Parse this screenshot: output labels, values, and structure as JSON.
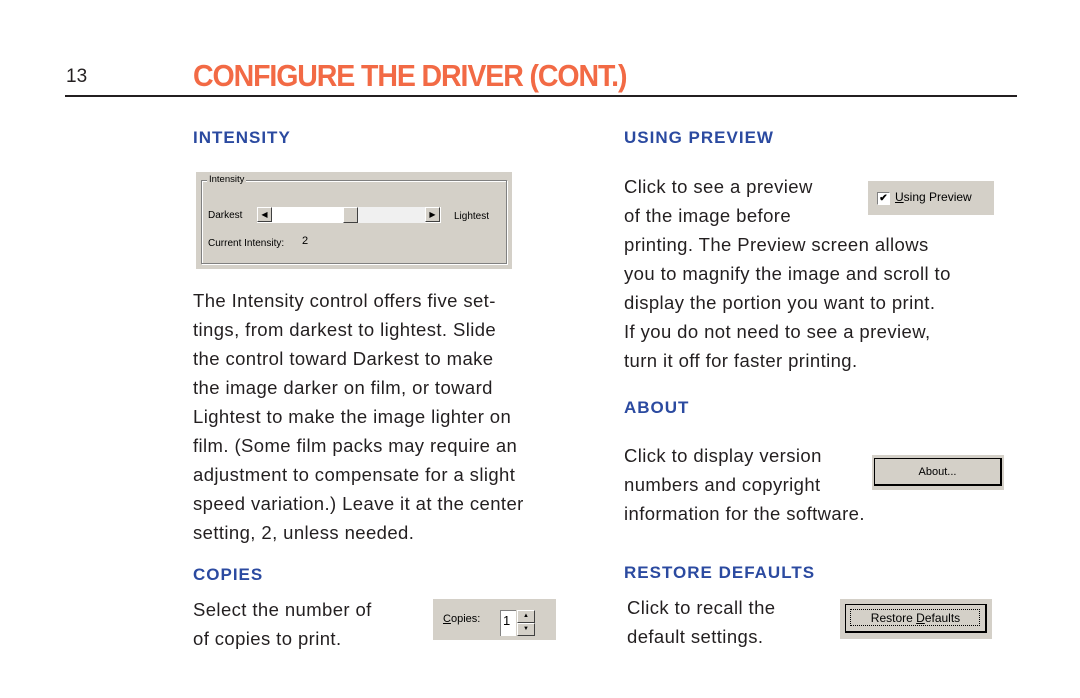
{
  "page": {
    "number": "13",
    "title": "CONFIGURE THE DRIVER (CONT.)",
    "colors": {
      "title": "#f26a45",
      "heading": "#2b4aa0",
      "text": "#231f20",
      "dialog_face": "#d4d0c8"
    }
  },
  "intensity": {
    "heading": "INTENSITY",
    "widget": {
      "group_label": "Intensity",
      "left_label": "Darkest",
      "right_label": "Lightest",
      "current_label": "Current Intensity:",
      "current_value": "2",
      "left_arrow_icon": "◀",
      "right_arrow_icon": "▶",
      "slider_position": "3 of 5 (center)"
    },
    "body_lines": [
      "The Intensity control offers five set-",
      "tings, from darkest to lightest. Slide",
      "the control toward Darkest to make",
      "the image darker on film, or toward",
      "Lightest to make the image lighter on",
      "film. (Some film packs may require an",
      "adjustment to compensate for a slight",
      "speed variation.) Leave it at the center",
      "setting, 2, unless needed."
    ]
  },
  "copies": {
    "heading": "COPIES",
    "body_lines": [
      "Select the number of",
      "of copies to print."
    ],
    "widget": {
      "label_first": "C",
      "label_rest": "opies:",
      "value": "1",
      "up_icon": "▲",
      "down_icon": "▼"
    }
  },
  "using_preview": {
    "heading": "USING PREVIEW",
    "body_lines_short": [
      "Click to see a preview",
      "of the image before"
    ],
    "body_lines": [
      "printing. The Preview screen allows",
      "you to magnify the image and scroll to",
      "display the portion you want to print.",
      "If you do not need to see a preview,",
      "turn it off for faster printing."
    ],
    "widget": {
      "checked": true,
      "check_icon": "✔",
      "label_first": "U",
      "label_rest": "sing Preview"
    }
  },
  "about": {
    "heading": "ABOUT",
    "body_lines_short": [
      "Click to display version",
      "numbers and copyright"
    ],
    "body_lines": [
      "information for the software."
    ],
    "widget": {
      "button_label": "About..."
    }
  },
  "restore_defaults": {
    "heading": "RESTORE DEFAULTS",
    "body_lines": [
      "Click to recall the",
      "default settings."
    ],
    "widget": {
      "label_before": "Restore ",
      "label_underlined": "D",
      "label_after": "efaults"
    }
  }
}
